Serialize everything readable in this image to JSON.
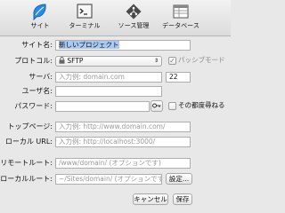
{
  "toolbar": {
    "items": [
      {
        "label": "サイト",
        "icon": "site-icon"
      },
      {
        "label": "ターミナル",
        "icon": "terminal-icon"
      },
      {
        "label": "ソース管理",
        "icon": "source-control-icon"
      },
      {
        "label": "データベース",
        "icon": "database-icon"
      }
    ]
  },
  "form": {
    "site_name": {
      "label": "サイト名:",
      "value": "新しいプロジェクト"
    },
    "protocol": {
      "label": "プロトコル:",
      "value": "SFTP",
      "passive_label": "パッシブモード",
      "passive_checked": true
    },
    "server": {
      "label": "サーバ:",
      "placeholder": "入力例: domain.com",
      "port": "22"
    },
    "user": {
      "label": "ユーザ名:",
      "value": ""
    },
    "password": {
      "label": "パスワード:",
      "value": "",
      "ask_label": "その都度尋ねる"
    },
    "top_page": {
      "label": "トップページ:",
      "placeholder": "入力例: http://www.domain.com/"
    },
    "local_url": {
      "label": "ローカル URL:",
      "placeholder": "入力例: http://localhost:3000/"
    },
    "remote_root": {
      "label": "リモートルート:",
      "placeholder": "/www/domain/ (オプションです)"
    },
    "local_root": {
      "label": "ローカルルート:",
      "placeholder": "~/Sites/domain/ (オプションです)",
      "settings_label": "設定..."
    }
  },
  "actions": {
    "cancel_label": "キャンセル",
    "save_label": "保存"
  }
}
